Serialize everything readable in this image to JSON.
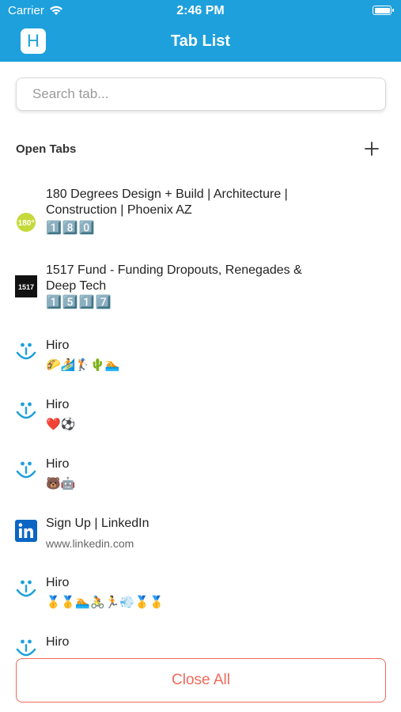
{
  "status": {
    "carrier": "Carrier",
    "time": "2:46 PM"
  },
  "header": {
    "app_icon_letter": "H",
    "title": "Tab List"
  },
  "search": {
    "placeholder": "Search tab..."
  },
  "section": {
    "title": "Open Tabs",
    "add_label": "+"
  },
  "tabs": [
    {
      "title": "180 Degrees Design + Build | Architecture | Construction | Phoenix AZ",
      "subtitle": "1️⃣8️⃣0️⃣",
      "icon": "180-logo-icon"
    },
    {
      "title": "1517 Fund - Funding Dropouts, Renegades & Deep Tech",
      "subtitle": "1️⃣5️⃣1️⃣7️⃣",
      "icon": "1517-logo-icon"
    },
    {
      "title": "Hiro",
      "subtitle": "🌮🏄🏌🌵🏊",
      "icon": "hiro-smile-icon"
    },
    {
      "title": "Hiro",
      "subtitle": "❤️⚽",
      "icon": "hiro-smile-icon"
    },
    {
      "title": "Hiro",
      "subtitle": "🐻🤖",
      "icon": "hiro-smile-icon"
    },
    {
      "title": "Sign Up | LinkedIn",
      "subtitle": "www.linkedin.com",
      "icon": "linkedin-icon"
    },
    {
      "title": "Hiro",
      "subtitle": "🥇🥇🏊🚴🏃💨🥇🥇",
      "icon": "hiro-smile-icon"
    },
    {
      "title": "Hiro",
      "subtitle": "",
      "icon": "hiro-smile-icon"
    }
  ],
  "footer": {
    "close_all_label": "Close All"
  },
  "colors": {
    "header": "#1ea0dc",
    "danger": "#f06a5a"
  }
}
